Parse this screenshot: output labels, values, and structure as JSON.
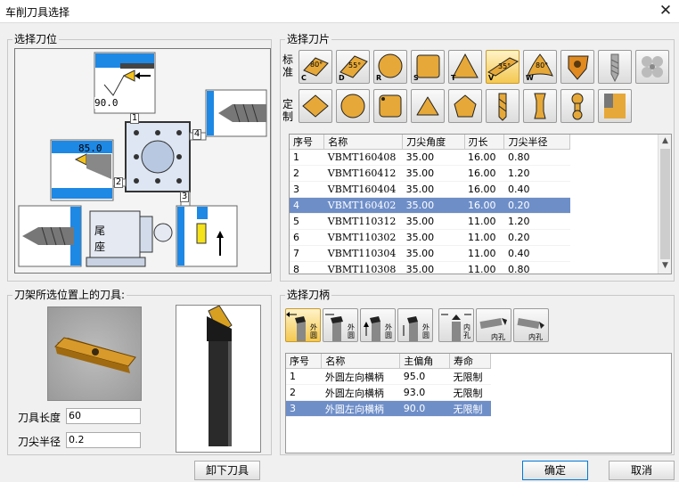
{
  "window": {
    "title": "车削刀具选择",
    "close": "✕"
  },
  "position_group": {
    "label": "选择刀位"
  },
  "scene": {
    "val_top": "90.0",
    "val_left": "85.0",
    "pos1": "1",
    "pos2": "2",
    "pos3": "3",
    "pos4": "4",
    "tail1": "尾",
    "tail2": "座"
  },
  "tool_group": {
    "label": "刀架所选位置上的刀具:"
  },
  "tool": {
    "len_label": "刀具长度",
    "len_value": "60",
    "rad_label": "刀尖半径",
    "rad_value": "0.2"
  },
  "unload_label": "卸下刀具",
  "insert_group": {
    "label": "选择刀片"
  },
  "standard_label": "标准",
  "custom_label": "定制",
  "std_buttons": [
    {
      "letter": "C",
      "angle": "80°"
    },
    {
      "letter": "D",
      "angle": "55°"
    },
    {
      "letter": "R"
    },
    {
      "letter": "S"
    },
    {
      "letter": "T"
    },
    {
      "letter": "V",
      "angle": "35°"
    },
    {
      "letter": "W",
      "angle": "80°"
    }
  ],
  "insert_table": {
    "headers": [
      "序号",
      "名称",
      "刀尖角度",
      "刃长",
      "刀尖半径"
    ],
    "rows": [
      [
        "1",
        "VBMT160408",
        "35.00",
        "16.00",
        "0.80"
      ],
      [
        "2",
        "VBMT160412",
        "35.00",
        "16.00",
        "1.20"
      ],
      [
        "3",
        "VBMT160404",
        "35.00",
        "16.00",
        "0.40"
      ],
      [
        "4",
        "VBMT160402",
        "35.00",
        "16.00",
        "0.20"
      ],
      [
        "5",
        "VBMT110312",
        "35.00",
        "11.00",
        "1.20"
      ],
      [
        "6",
        "VBMT110302",
        "35.00",
        "11.00",
        "0.20"
      ],
      [
        "7",
        "VBMT110304",
        "35.00",
        "11.00",
        "0.40"
      ],
      [
        "8",
        "VBMT110308",
        "35.00",
        "11.00",
        "0.80"
      ]
    ],
    "selected": 3
  },
  "holder_group": {
    "label": "选择刀柄"
  },
  "holder_buttons": [
    "外圆",
    "外圆",
    "外圆",
    "外圆",
    "内孔",
    "内孔"
  ],
  "holder_table": {
    "headers": [
      "序号",
      "名称",
      "主偏角",
      "寿命"
    ],
    "rows": [
      [
        "1",
        "外圆左向横柄",
        "95.0",
        "无限制"
      ],
      [
        "2",
        "外圆左向横柄",
        "93.0",
        "无限制"
      ],
      [
        "3",
        "外圆左向横柄",
        "90.0",
        "无限制"
      ]
    ],
    "selected": 2
  },
  "confirm_label": "确定",
  "cancel_label": "取消"
}
